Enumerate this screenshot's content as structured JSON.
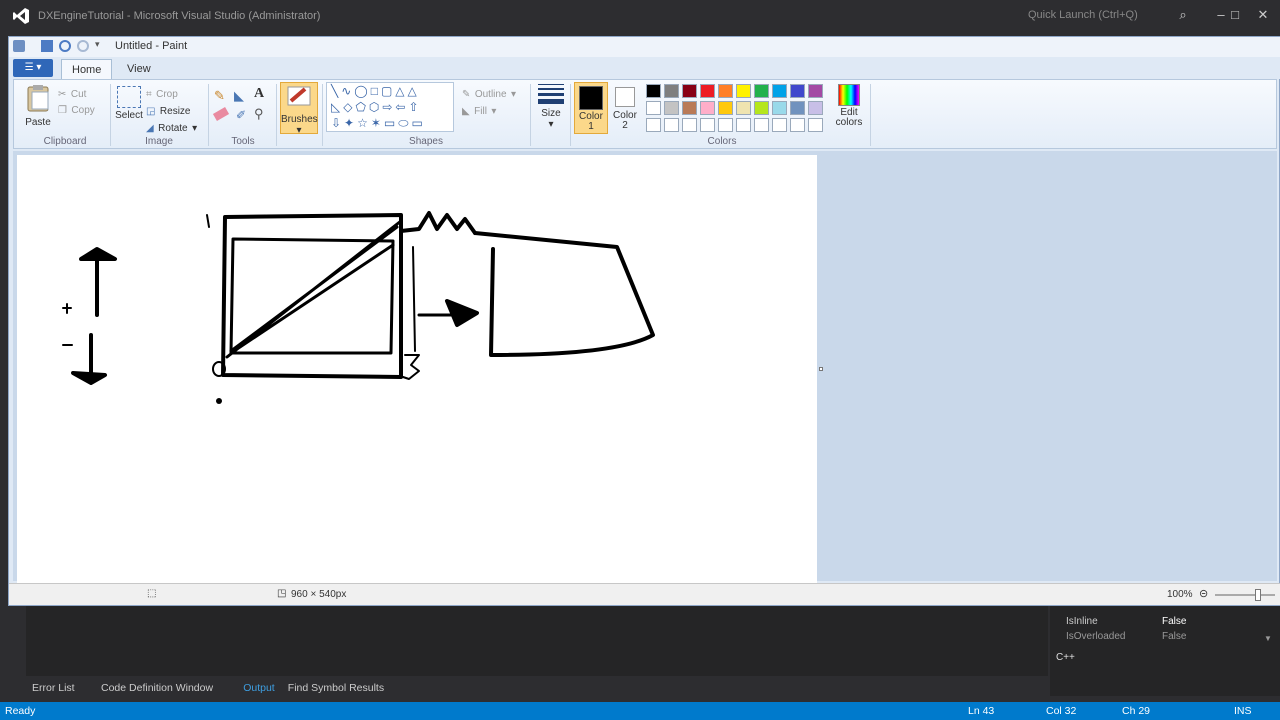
{
  "vs": {
    "title": "DXEngineTutorial - Microsoft Visual Studio (Administrator)",
    "quick_launch": "Quick Launch (Ctrl+Q)",
    "bottom_tabs": [
      "Error List",
      "Code Definition Window",
      "Output",
      "Find Symbol Results"
    ],
    "active_bottom_tab": "Output",
    "properties": [
      {
        "name": "IsInline",
        "value": "False"
      },
      {
        "name": "IsOverloaded",
        "value": "False"
      }
    ],
    "properties_footer": "C++",
    "status": {
      "left": "Ready",
      "ln": "Ln 43",
      "col": "Col 32",
      "ch": "Ch 29",
      "mode": "INS"
    },
    "accent": "#007acc"
  },
  "paint": {
    "title": "Untitled - Paint",
    "tabs": {
      "file": "",
      "home": "Home",
      "view": "View"
    },
    "clipboard": {
      "paste": "Paste",
      "cut": "Cut",
      "copy": "Copy",
      "group": "Clipboard"
    },
    "image": {
      "select": "Select",
      "crop": "Crop",
      "resize": "Resize",
      "rotate": "Rotate",
      "group": "Image"
    },
    "tools": {
      "group": "Tools"
    },
    "brushes": {
      "label": "Brushes"
    },
    "shapes": {
      "outline": "Outline",
      "fill": "Fill",
      "group": "Shapes"
    },
    "size": {
      "label": "Size"
    },
    "color1": {
      "label": "Color",
      "num": "1"
    },
    "color2": {
      "label": "Color",
      "num": "2"
    },
    "colors": {
      "group": "Colors",
      "edit": "Edit colors",
      "row1": [
        "#000000",
        "#7f7f7f",
        "#880015",
        "#ed1c24",
        "#ff7f27",
        "#fff200",
        "#22b14c",
        "#00a2e8",
        "#3f48cc",
        "#a349a4"
      ],
      "row2": [
        "#ffffff",
        "#c3c3c3",
        "#b97a57",
        "#ffaec9",
        "#ffc90e",
        "#efe4b0",
        "#b5e61d",
        "#99d9ea",
        "#7092be",
        "#c8bfe7"
      ]
    },
    "status": {
      "dimensions": "960 × 540px",
      "zoom": "100%"
    }
  }
}
